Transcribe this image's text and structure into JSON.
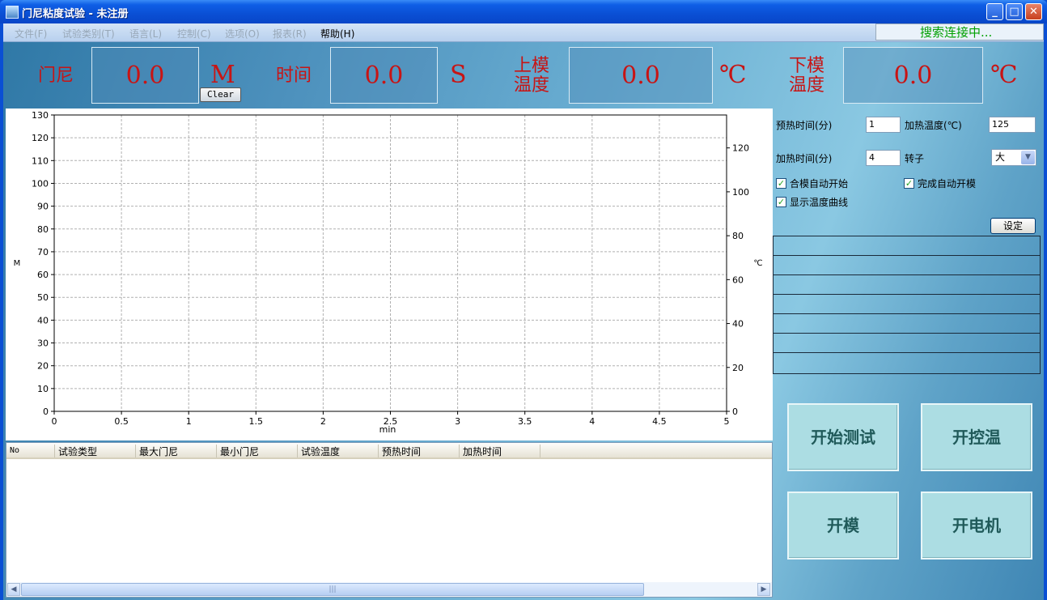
{
  "window": {
    "title": "门尼粘度试验 - 未注册",
    "min_symbol": "_",
    "max_symbol": "□",
    "close_symbol": "✕"
  },
  "menu": {
    "items": [
      "文件(F)",
      "试验类别(T)",
      "语言(L)",
      "控制(C)",
      "选项(O)",
      "报表(R)",
      "帮助(H)"
    ],
    "status": "搜索连接中..."
  },
  "readouts": {
    "mooney": {
      "label": "门尼",
      "value": "0.0",
      "unit": "M"
    },
    "time": {
      "label": "时间",
      "value": "0.0",
      "unit": "S"
    },
    "upper_temp": {
      "label_line1": "上模",
      "label_line2": "温度",
      "value": "0.0",
      "unit": "℃"
    },
    "lower_temp": {
      "label_line1": "下模",
      "label_line2": "温度",
      "value": "0.0",
      "unit": "℃"
    },
    "clear_label": "Clear"
  },
  "chart_data": {
    "type": "line",
    "xlabel": "min",
    "ylabel": "M",
    "y2label": "℃",
    "xlim": [
      0,
      5
    ],
    "ylim": [
      0,
      130
    ],
    "y2lim": [
      0,
      135
    ],
    "x_ticks": [
      "0",
      "0.5",
      "1",
      "1.5",
      "2",
      "2.5",
      "3",
      "3.5",
      "4",
      "4.5",
      "5"
    ],
    "y_ticks": [
      "0",
      "10",
      "20",
      "30",
      "40",
      "50",
      "60",
      "70",
      "80",
      "90",
      "100",
      "110",
      "120",
      "130"
    ],
    "y2_ticks": [
      "0",
      "20",
      "40",
      "60",
      "80",
      "100",
      "120"
    ],
    "grid": true,
    "series": []
  },
  "table": {
    "headers": [
      "No",
      "试验类型",
      "最大门尼",
      "最小门尼",
      "试验温度",
      "预热时间",
      "加热时间"
    ],
    "rows": []
  },
  "settings": {
    "preheat_label": "预热时间(分)",
    "preheat_value": "1",
    "heat_temp_label": "加热温度(℃)",
    "heat_temp_value": "125",
    "heat_time_label": "加热时间(分)",
    "heat_time_value": "4",
    "rotor_label": "转子",
    "rotor_value": "大",
    "auto_start_label": "合模自动开始",
    "auto_start_checked": true,
    "auto_open_label": "完成自动开模",
    "auto_open_checked": true,
    "show_temp_label": "显示温度曲线",
    "show_temp_checked": true,
    "set_label": "设定"
  },
  "actions": {
    "start_test": "开始测试",
    "temp_control": "开控温",
    "open_mold": "开模",
    "motor": "开电机"
  }
}
